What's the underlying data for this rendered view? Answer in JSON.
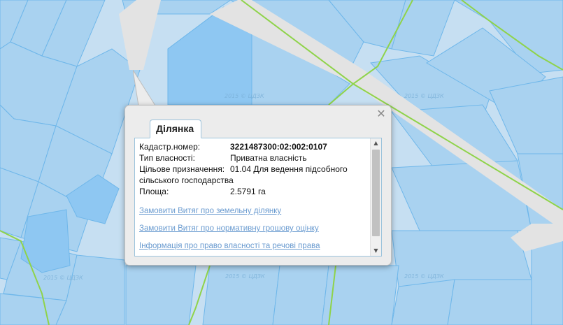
{
  "map": {
    "watermark": "2015 © ЦДЗК",
    "colors": {
      "background": "#c6dff2",
      "parcel": "#a9d2f0",
      "parcel_dark": "#8ec7f2",
      "border": "#6fb7ea",
      "road": "#e3e3e3",
      "green_line": "#8fd34a"
    }
  },
  "popup": {
    "tab_label": "Ділянка",
    "close_icon": "close-icon",
    "fields": {
      "cadastral": {
        "label": "Кадастр.номер:",
        "value": "3221487300:02:002:0107"
      },
      "ownership": {
        "label": "Тип власності:",
        "value": "Приватна власність"
      },
      "purpose": {
        "label": "Цільове призначення:",
        "value_line1": "01.04 Для ведення підсобного",
        "value_line2": "сільського господарства"
      },
      "area": {
        "label": "Площа:",
        "value": "2.5791 га"
      }
    },
    "links": {
      "extract_parcel": "Замовити Витяг про земельну ділянку",
      "extract_valuation": "Замовити Витяг про нормативну грошову оцінку",
      "ownership_info": "Інформація про право власності та речові права"
    }
  }
}
